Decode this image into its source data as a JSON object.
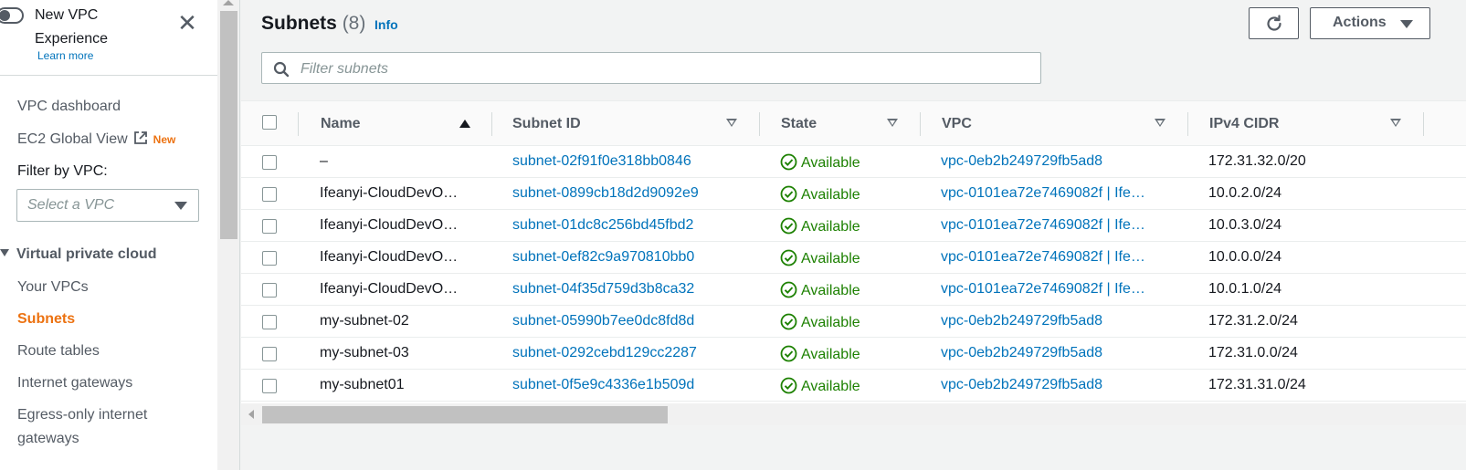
{
  "sidebar": {
    "new_vpc_title": "New VPC Experience",
    "learn_more": "Learn more",
    "nav_dashboard": "VPC dashboard",
    "nav_ec2_global": "EC2 Global View",
    "new_badge": "New",
    "filter_label": "Filter by VPC:",
    "select_placeholder": "Select a VPC",
    "section_title": "Virtual private cloud",
    "items": [
      "Your VPCs",
      "Subnets",
      "Route tables",
      "Internet gateways",
      "Egress-only internet",
      "gateways"
    ],
    "active_item": "Subnets"
  },
  "header": {
    "title": "Subnets",
    "count": "(8)",
    "info": "Info",
    "actions_label": "Actions"
  },
  "search": {
    "placeholder": "Filter subnets"
  },
  "table": {
    "columns": [
      "Name",
      "Subnet ID",
      "State",
      "VPC",
      "IPv4 CIDR"
    ],
    "rows": [
      {
        "name": "–",
        "subnet_id": "subnet-02f91f0e318bb0846",
        "state": "Available",
        "vpc": "vpc-0eb2b249729fb5ad8",
        "cidr": "172.31.32.0/20"
      },
      {
        "name": "Ifeanyi-CloudDevO…",
        "subnet_id": "subnet-0899cb18d2d9092e9",
        "state": "Available",
        "vpc": "vpc-0101ea72e7469082f | Ife…",
        "cidr": "10.0.2.0/24"
      },
      {
        "name": "Ifeanyi-CloudDevO…",
        "subnet_id": "subnet-01dc8c256bd45fbd2",
        "state": "Available",
        "vpc": "vpc-0101ea72e7469082f | Ife…",
        "cidr": "10.0.3.0/24"
      },
      {
        "name": "Ifeanyi-CloudDevO…",
        "subnet_id": "subnet-0ef82c9a970810bb0",
        "state": "Available",
        "vpc": "vpc-0101ea72e7469082f | Ife…",
        "cidr": "10.0.0.0/24"
      },
      {
        "name": "Ifeanyi-CloudDevO…",
        "subnet_id": "subnet-04f35d759d3b8ca32",
        "state": "Available",
        "vpc": "vpc-0101ea72e7469082f | Ife…",
        "cidr": "10.0.1.0/24"
      },
      {
        "name": "my-subnet-02",
        "subnet_id": "subnet-05990b7ee0dc8fd8d",
        "state": "Available",
        "vpc": "vpc-0eb2b249729fb5ad8",
        "cidr": "172.31.2.0/24"
      },
      {
        "name": "my-subnet-03",
        "subnet_id": "subnet-0292cebd129cc2287",
        "state": "Available",
        "vpc": "vpc-0eb2b249729fb5ad8",
        "cidr": "172.31.0.0/24"
      },
      {
        "name": "my-subnet01",
        "subnet_id": "subnet-0f5e9c4336e1b509d",
        "state": "Available",
        "vpc": "vpc-0eb2b249729fb5ad8",
        "cidr": "172.31.31.0/24"
      }
    ]
  },
  "colors": {
    "accent": "#ec7211",
    "link": "#0073bb",
    "success": "#1d8102"
  }
}
